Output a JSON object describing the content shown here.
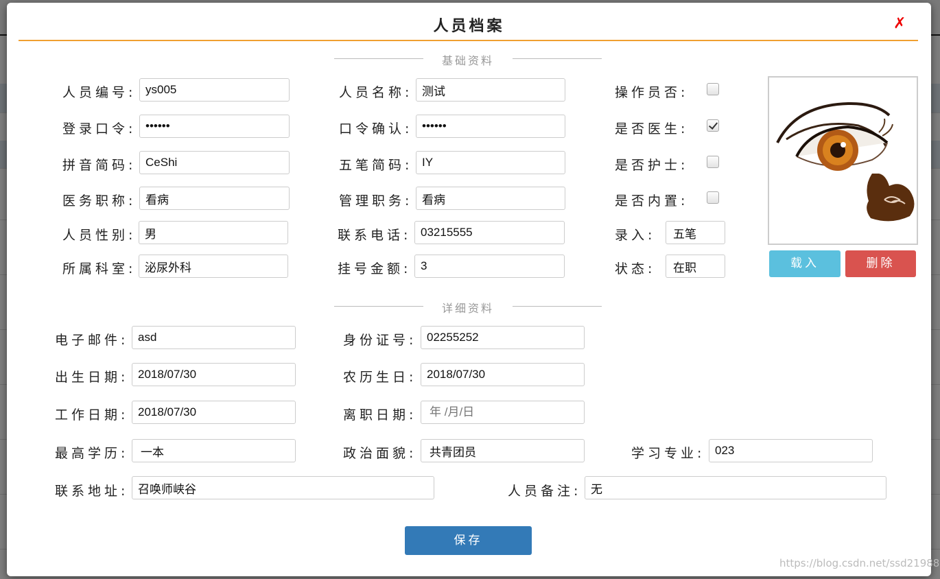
{
  "modal": {
    "title": "人员档案",
    "close_label": "✗"
  },
  "sections": {
    "basic": "基础资料",
    "detail": "详细资料"
  },
  "basic": {
    "staff_id": {
      "label": "人员编号:",
      "value": "ys005"
    },
    "staff_name": {
      "label": "人员名称:",
      "value": "测试"
    },
    "login_password": {
      "label": "登录口令:",
      "value": "••••••"
    },
    "password_confirm": {
      "label": "口令确认:",
      "value": "••••••"
    },
    "pinyin_code": {
      "label": "拼音简码:",
      "value": "CeShi"
    },
    "wubi_code": {
      "label": "五笔简码:",
      "value": "IY"
    },
    "medical_title": {
      "label": "医务职称:",
      "value": "看病"
    },
    "admin_title": {
      "label": "管理职务:",
      "value": "看病"
    },
    "gender": {
      "label": "人员性别:",
      "value": "男"
    },
    "phone": {
      "label": "联系电话:",
      "value": "03215555"
    },
    "department": {
      "label": "所属科室:",
      "value": "泌尿外科"
    },
    "reg_fee": {
      "label": "挂号金额:",
      "value": "3"
    },
    "is_operator": {
      "label": "操作员否:",
      "checked": false
    },
    "is_doctor": {
      "label": "是否医生:",
      "checked": true
    },
    "is_nurse": {
      "label": "是否护士:",
      "checked": false
    },
    "is_builtin": {
      "label": "是否内置:",
      "checked": false
    },
    "input_method": {
      "label": "录入:",
      "value": "五笔"
    },
    "status": {
      "label": "状态:",
      "value": "在职"
    }
  },
  "photo": {
    "load_label": "载入",
    "delete_label": "删除"
  },
  "detail": {
    "email": {
      "label": "电子邮件:",
      "value": "asd"
    },
    "id_number": {
      "label": "身份证号:",
      "value": "02255252"
    },
    "birth_date": {
      "label": "出生日期:",
      "value": "2018/07/30"
    },
    "lunar_birthday": {
      "label": "农历生日:",
      "value": "2018/07/30"
    },
    "work_date": {
      "label": "工作日期:",
      "value": "2018/07/30"
    },
    "leave_date": {
      "label": "离职日期:",
      "value": "",
      "placeholder": "年 /月/日"
    },
    "education": {
      "label": "最高学历:",
      "value": "一本"
    },
    "political": {
      "label": "政治面貌:",
      "value": "共青团员"
    },
    "major": {
      "label": "学习专业:",
      "value": "023"
    },
    "address": {
      "label": "联系地址:",
      "value": "召唤师峡谷"
    },
    "remarks": {
      "label": "人员备注:",
      "value": "无"
    }
  },
  "save_label": "保存",
  "watermark": "https://blog.csdn.net/ssd21988",
  "colors": {
    "accent_line": "#f0a030",
    "load_button": "#5bc0de",
    "delete_button": "#d9534f",
    "save_button": "#337ab7",
    "close": "#ee0000"
  }
}
